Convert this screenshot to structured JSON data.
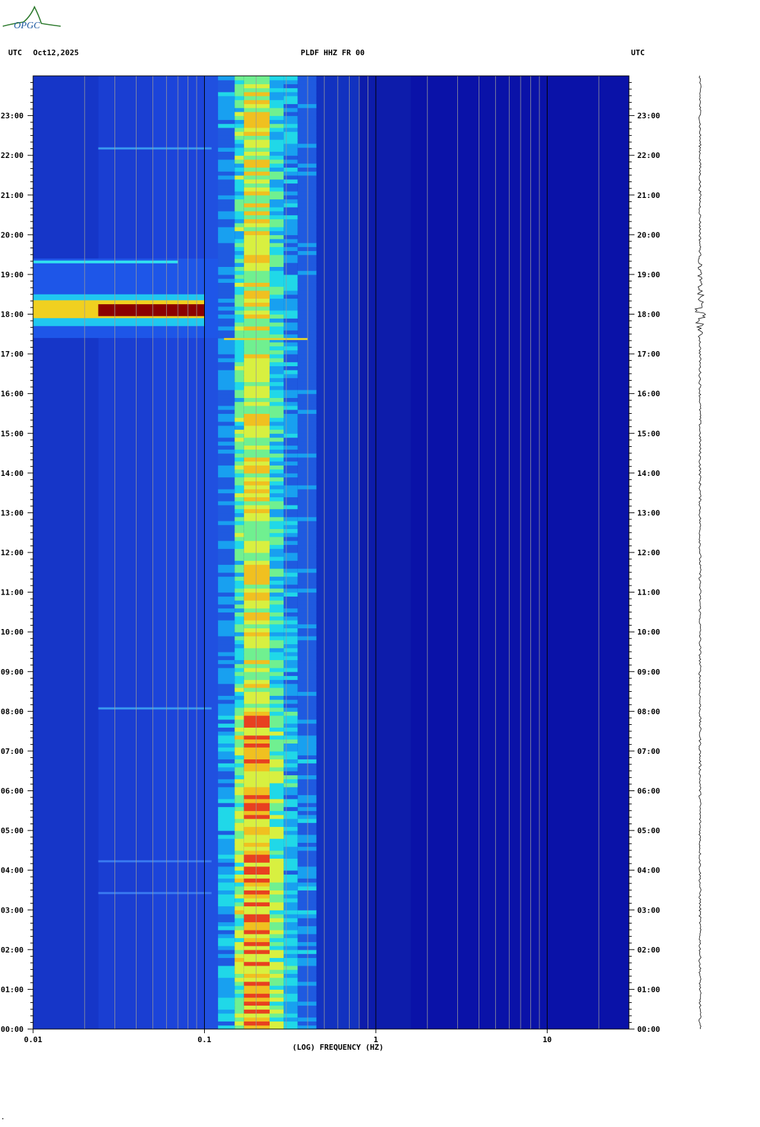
{
  "header": {
    "left_utc": "UTC",
    "date": "Oct12,2025",
    "station": "PLDF HHZ FR 00",
    "right_utc": "UTC"
  },
  "logo": {
    "text": "OPGC",
    "color": "#3a8a3a"
  },
  "footer_mark": "\"",
  "chart_data": {
    "type": "heatmap",
    "title": "PLDF HHZ FR 00",
    "xlabel": "(LOG) FREQUENCY (HZ)",
    "x_scale": "log",
    "xlim": [
      0.01,
      30
    ],
    "x_ticks": [
      {
        "value": 0.01,
        "label": "0.01"
      },
      {
        "value": 0.1,
        "label": "0.1"
      },
      {
        "value": 1,
        "label": "1"
      },
      {
        "value": 10,
        "label": "10"
      }
    ],
    "y_ticks": [
      "00:00",
      "01:00",
      "02:00",
      "03:00",
      "04:00",
      "05:00",
      "06:00",
      "07:00",
      "08:00",
      "09:00",
      "10:00",
      "11:00",
      "12:00",
      "13:00",
      "14:00",
      "15:00",
      "16:00",
      "17:00",
      "18:00",
      "19:00",
      "20:00",
      "21:00",
      "22:00",
      "23:00"
    ],
    "ylim_hours": [
      0,
      24
    ],
    "microseism_band_hz": [
      0.12,
      0.45
    ],
    "microseism_peak_hz": 0.2,
    "event": {
      "time_hours": 18.1,
      "start_hours": 17.4,
      "end_hours": 19.4,
      "freq_max_hz": 0.12
    },
    "colors": {
      "background": "#0a12a8",
      "low": "#1f3fd8",
      "mid": "#14c8f0",
      "high": "#f0f030",
      "peak": "#8b0000"
    }
  }
}
